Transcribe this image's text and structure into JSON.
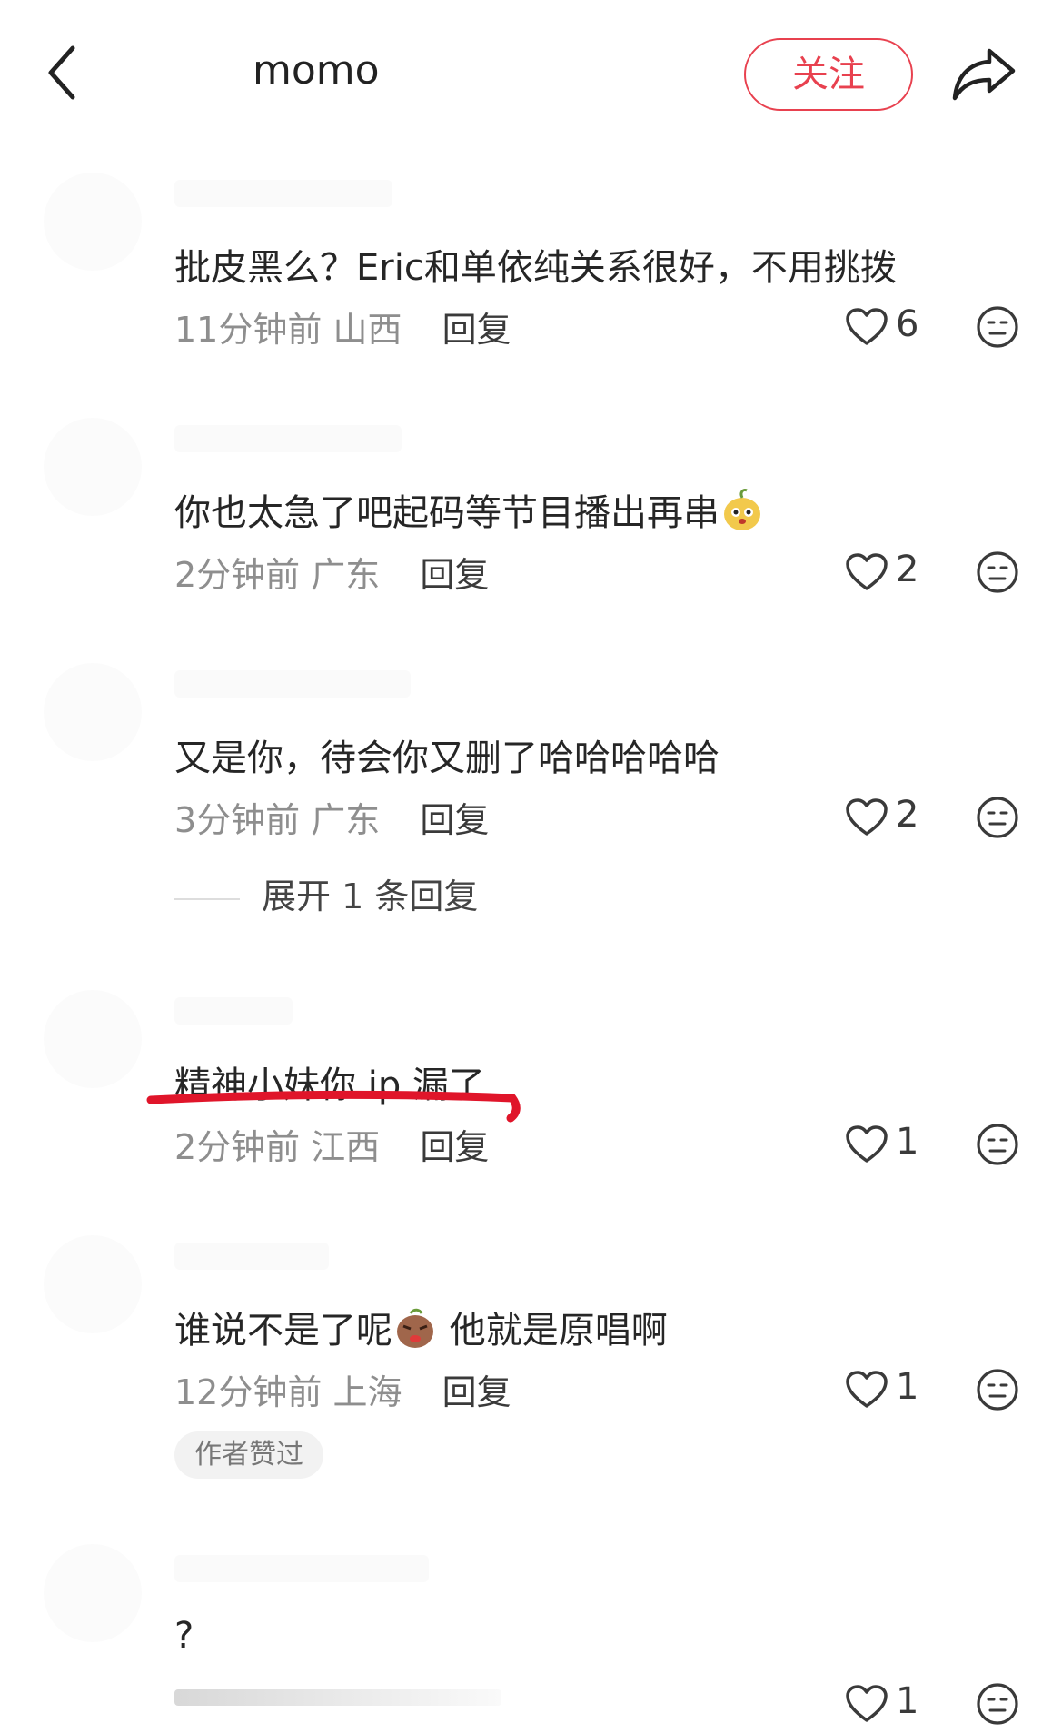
{
  "header": {
    "author": "momo",
    "follow_label": "关注"
  },
  "comments": [
    {
      "text": "批皮黑么？Eric和单依纯关系很好，不用挑拨",
      "time": "11分钟前",
      "location": "山西",
      "reply_label": "回复",
      "likes": "6"
    },
    {
      "text": "你也太急了吧起码等节目播出再串",
      "emoji": "pear-face-emoji",
      "time": "2分钟前",
      "location": "广东",
      "reply_label": "回复",
      "likes": "2"
    },
    {
      "text": "又是你，待会你又删了哈哈哈哈哈",
      "time": "3分钟前",
      "location": "广东",
      "reply_label": "回复",
      "likes": "2",
      "expand_label": "展开 1 条回复"
    },
    {
      "text": "精神小妹你 ip 漏了",
      "time": "2分钟前",
      "location": "江西",
      "reply_label": "回复",
      "likes": "1",
      "highlight_color": "#e0152a"
    },
    {
      "text_before": "谁说不是了呢",
      "emoji": "angry-potato-emoji",
      "text_after": " 他就是原唱啊",
      "time": "12分钟前",
      "location": "上海",
      "reply_label": "回复",
      "likes": "1",
      "badge": "作者赞过"
    },
    {
      "text": "?",
      "likes": "1"
    }
  ],
  "colors": {
    "accent": "#e8414f",
    "meta": "#8e8e8e"
  }
}
